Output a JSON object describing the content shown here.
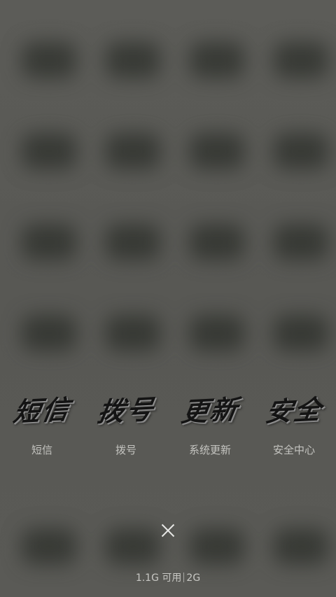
{
  "shortcuts": [
    {
      "calligraphy": "短信",
      "label": "短信",
      "icon": "messages-icon"
    },
    {
      "calligraphy": "拨号",
      "label": "拨号",
      "icon": "dialer-icon"
    },
    {
      "calligraphy": "更新",
      "label": "系统更新",
      "icon": "system-update-icon"
    },
    {
      "calligraphy": "安全",
      "label": "安全中心",
      "icon": "security-center-icon"
    }
  ],
  "close_icon": "close-icon",
  "memory": {
    "available": "1.1G 可用",
    "total": "2G"
  },
  "colors": {
    "background": "#5a5a56",
    "label": "#c4c4c0",
    "calligraphy": "#141414"
  }
}
